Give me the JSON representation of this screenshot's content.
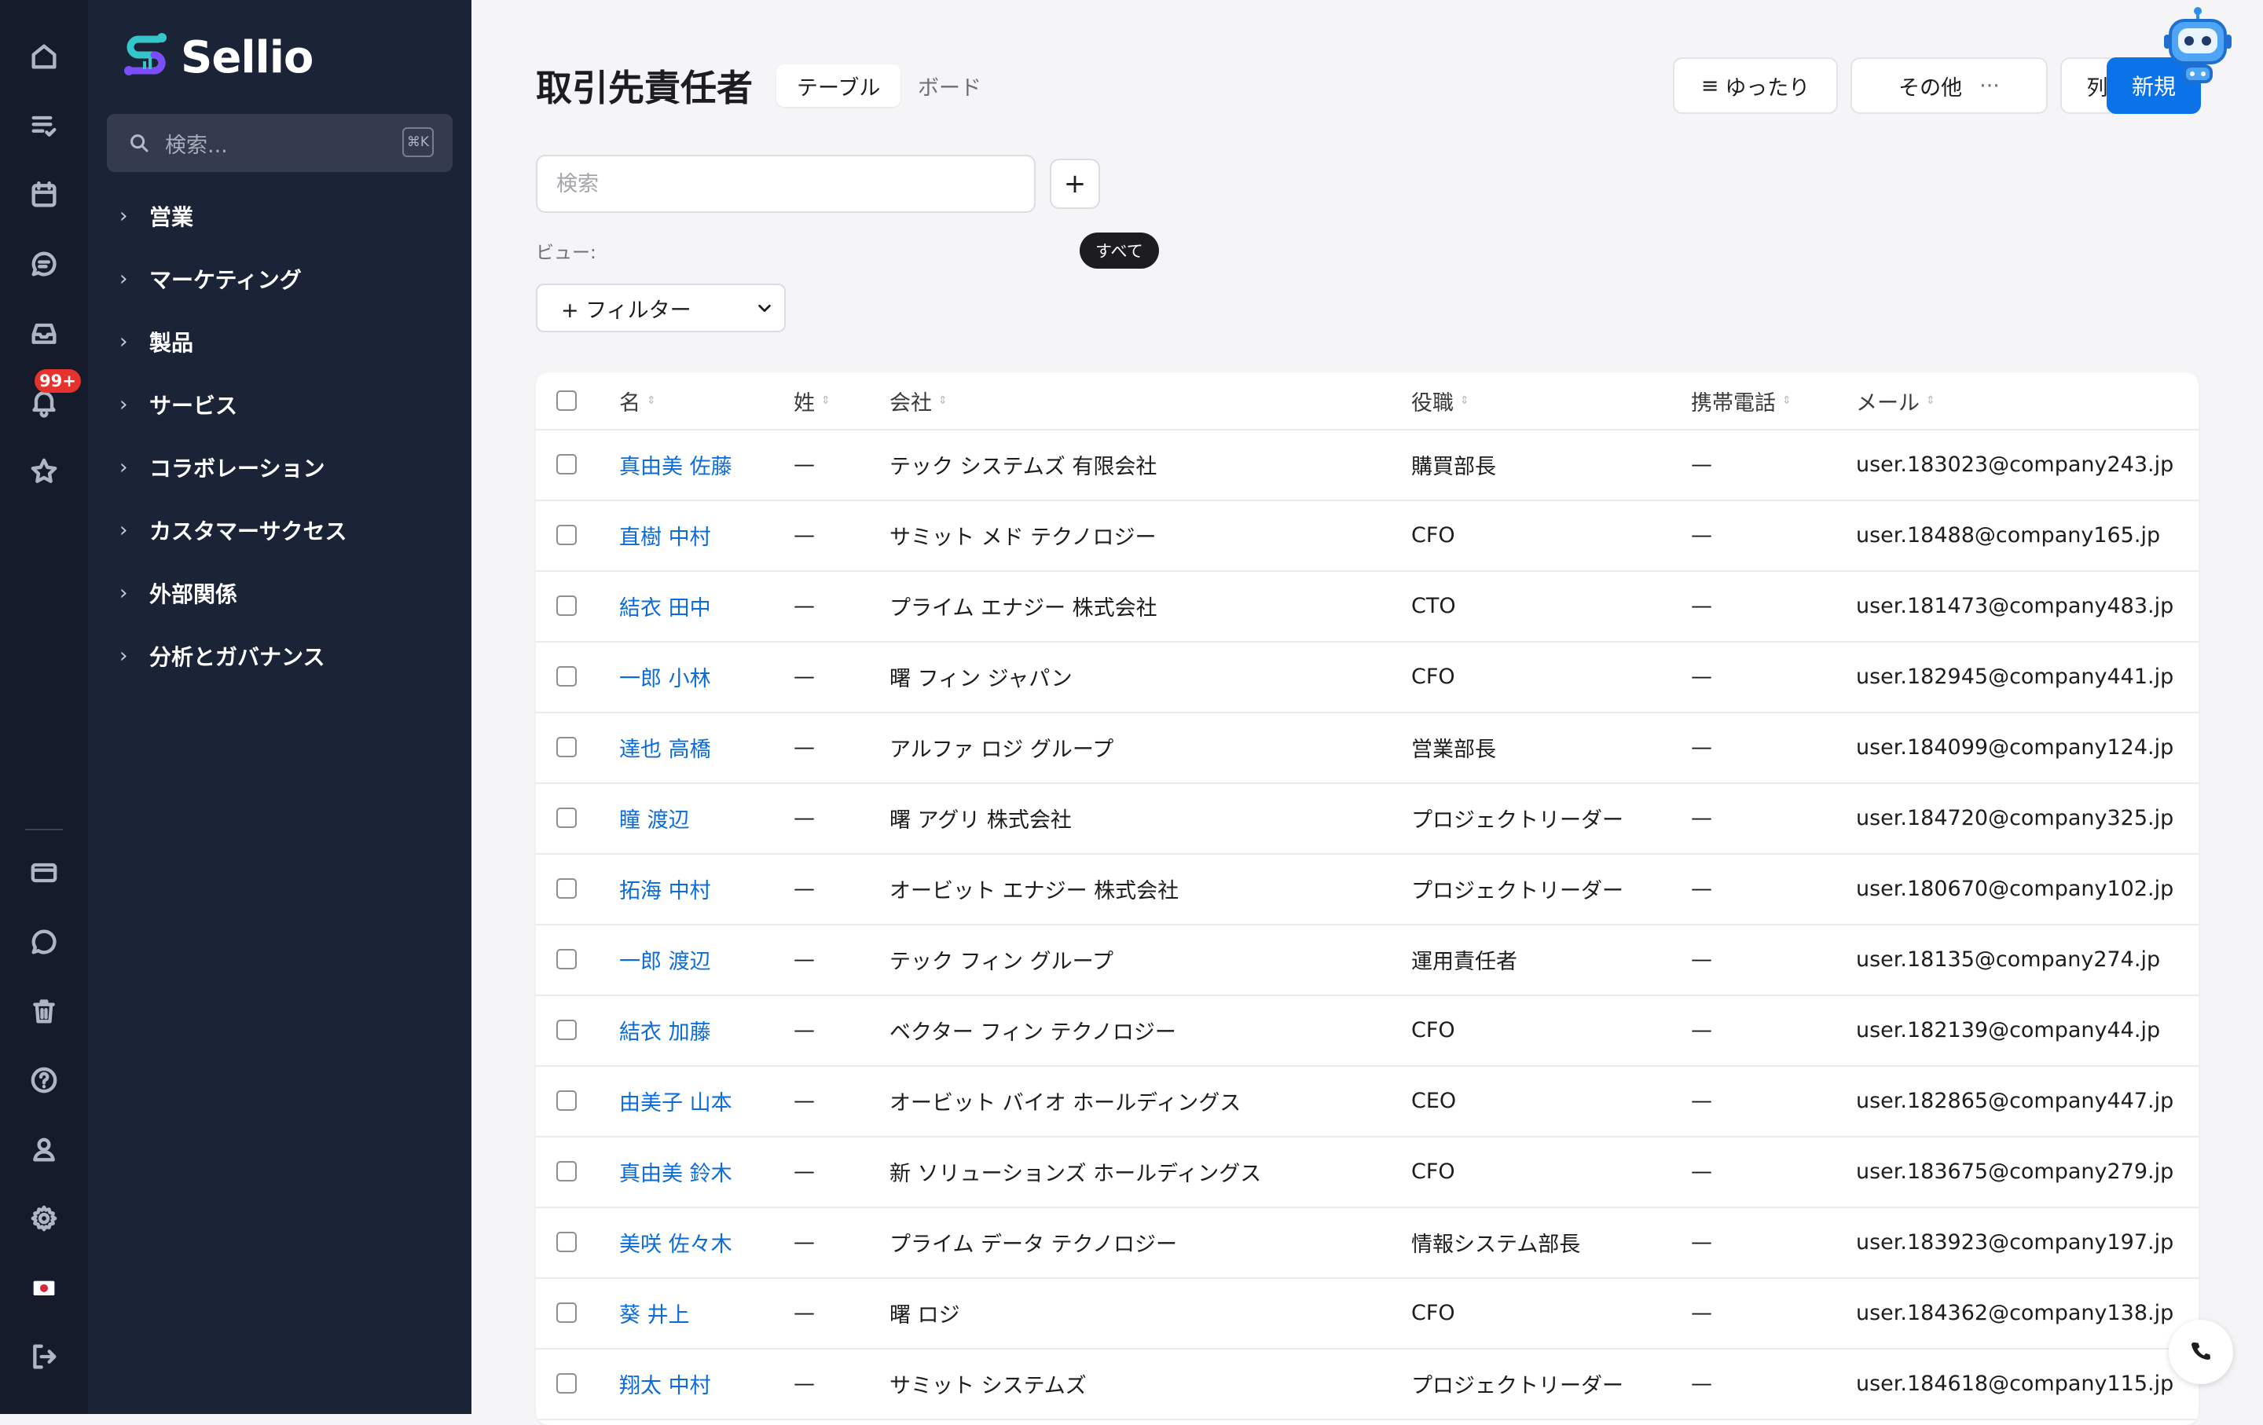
{
  "rail": {
    "notification_badge": "99+",
    "icons_top": [
      "home-icon",
      "tasks-icon",
      "calendar-icon",
      "chat-icon",
      "inbox-icon",
      "bell-icon",
      "star-icon"
    ],
    "icons_bottom": [
      "card-icon",
      "message-icon",
      "trash-icon",
      "help-icon",
      "user-icon",
      "gear-icon",
      "flag-icon",
      "logout-icon"
    ]
  },
  "sidebar": {
    "brand": "Sellio",
    "search_placeholder": "検索...",
    "shortcut": "⌘K",
    "items": [
      {
        "label": "営業"
      },
      {
        "label": "マーケティング"
      },
      {
        "label": "製品"
      },
      {
        "label": "サービス"
      },
      {
        "label": "コラボレーション"
      },
      {
        "label": "カスタマーサクセス"
      },
      {
        "label": "外部関係"
      },
      {
        "label": "分析とガバナンス"
      }
    ]
  },
  "header": {
    "title": "取引先責任者",
    "tab_table": "テーブル",
    "tab_board": "ボード",
    "density_label": "ゆったり",
    "other_label": "その他",
    "columns_label": "列",
    "new_label": "新規"
  },
  "toolbar": {
    "search_placeholder": "検索",
    "add_label": "+",
    "view_label": "ビュー:",
    "view_chip": "すべて",
    "filter_label": "+ フィルター"
  },
  "table": {
    "columns": [
      "名",
      "姓",
      "会社",
      "役職",
      "携帯電話",
      "メール"
    ],
    "rows": [
      {
        "first": "真由美 佐藤",
        "last": "—",
        "company": "テック システムズ 有限会社",
        "title": "購買部長",
        "mobile": "—",
        "email": "user.183023@company243.jp"
      },
      {
        "first": "直樹 中村",
        "last": "—",
        "company": "サミット メド テクノロジー",
        "title": "CFO",
        "mobile": "—",
        "email": "user.18488@company165.jp"
      },
      {
        "first": "結衣 田中",
        "last": "—",
        "company": "プライム エナジー 株式会社",
        "title": "CTO",
        "mobile": "—",
        "email": "user.181473@company483.jp"
      },
      {
        "first": "一郎 小林",
        "last": "—",
        "company": "曙 フィン ジャパン",
        "title": "CFO",
        "mobile": "—",
        "email": "user.182945@company441.jp"
      },
      {
        "first": "達也 高橋",
        "last": "—",
        "company": "アルファ ロジ グループ",
        "title": "営業部長",
        "mobile": "—",
        "email": "user.184099@company124.jp"
      },
      {
        "first": "瞳 渡辺",
        "last": "—",
        "company": "曙 アグリ 株式会社",
        "title": "プロジェクトリーダー",
        "mobile": "—",
        "email": "user.184720@company325.jp"
      },
      {
        "first": "拓海 中村",
        "last": "—",
        "company": "オービット エナジー 株式会社",
        "title": "プロジェクトリーダー",
        "mobile": "—",
        "email": "user.180670@company102.jp"
      },
      {
        "first": "一郎 渡辺",
        "last": "—",
        "company": "テック フィン グループ",
        "title": "運用責任者",
        "mobile": "—",
        "email": "user.18135@company274.jp"
      },
      {
        "first": "結衣 加藤",
        "last": "—",
        "company": "ベクター フィン テクノロジー",
        "title": "CFO",
        "mobile": "—",
        "email": "user.182139@company44.jp"
      },
      {
        "first": "由美子 山本",
        "last": "—",
        "company": "オービット バイオ ホールディングス",
        "title": "CEO",
        "mobile": "—",
        "email": "user.182865@company447.jp"
      },
      {
        "first": "真由美 鈴木",
        "last": "—",
        "company": "新 ソリューションズ ホールディングス",
        "title": "CFO",
        "mobile": "—",
        "email": "user.183675@company279.jp"
      },
      {
        "first": "美咲 佐々木",
        "last": "—",
        "company": "プライム データ テクノロジー",
        "title": "情報システム部長",
        "mobile": "—",
        "email": "user.183923@company197.jp"
      },
      {
        "first": "葵 井上",
        "last": "—",
        "company": "曙 ロジ",
        "title": "CFO",
        "mobile": "—",
        "email": "user.184362@company138.jp"
      },
      {
        "first": "翔太 中村",
        "last": "—",
        "company": "サミット システムズ",
        "title": "プロジェクトリーダー",
        "mobile": "—",
        "email": "user.184618@company115.jp"
      }
    ]
  },
  "colors": {
    "accent": "#0b72e7",
    "link": "#0b6bd8",
    "rail_bg": "#151b2b",
    "sidebar_bg": "#1b2337",
    "badge": "#e5322d"
  }
}
